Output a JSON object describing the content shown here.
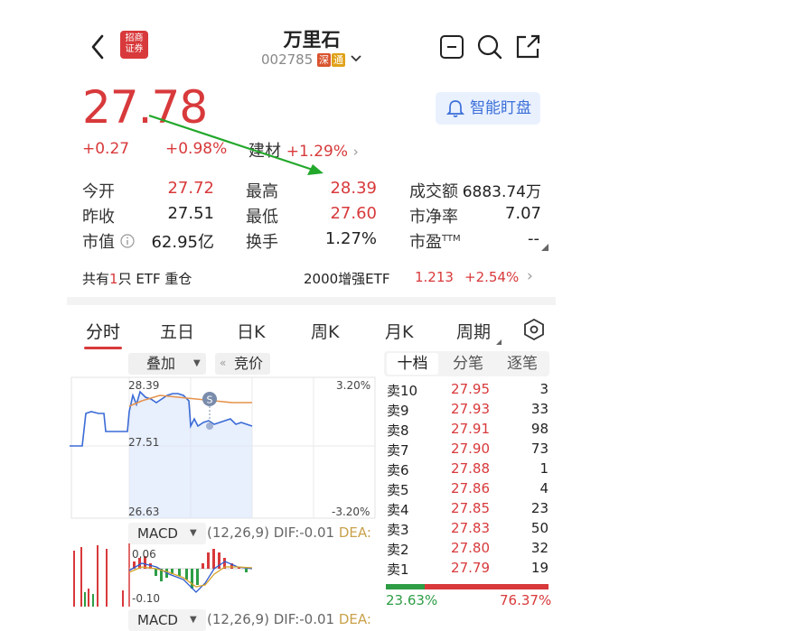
{
  "header": {
    "back_icon": "chevron-left-icon",
    "broker_logo_text": "招商证券",
    "title": "万里石",
    "code": "002785",
    "badge_market": "深",
    "badge_tong": "通",
    "actions": [
      "minus-box-icon",
      "search-icon",
      "share-icon"
    ]
  },
  "quote": {
    "price": "27.78",
    "change": "+0.27",
    "change_pct": "+0.98%",
    "sector_name": "建材",
    "sector_pct": "+1.29%",
    "watch_label": "智能盯盘"
  },
  "stats": {
    "open_label": "今开",
    "open": "27.72",
    "high_label": "最高",
    "high": "28.39",
    "turnover_amt_label": "成交额",
    "turnover_amt": "6883.74万",
    "prev_close_label": "昨收",
    "prev_close": "27.51",
    "low_label": "最低",
    "low": "27.60",
    "pb_label": "市净率",
    "pb": "7.07",
    "mcap_label": "市值",
    "mcap": "62.95亿",
    "turnover_label": "换手",
    "turnover": "1.27%",
    "pe_label": "市盈",
    "pe_sup": "TTM",
    "pe": "--"
  },
  "etf": {
    "p1": "共有",
    "count": "1",
    "p2": "只 ETF 重仓",
    "name": "2000增强ETF",
    "price": "1.213",
    "pct": "+2.54%"
  },
  "tabs": [
    "分时",
    "五日",
    "日K",
    "周K",
    "月K",
    "周期"
  ],
  "chart_toolbar": {
    "overlay": "叠加",
    "auction": "竞价"
  },
  "chart_labels": {
    "top": "28.39",
    "mid": "27.51",
    "bot": "26.63",
    "pct_top": "3.20%",
    "pct_bot": "-3.20%",
    "marker": "S"
  },
  "macd": {
    "label": "MACD",
    "params": "(12,26,9)",
    "dif": "DIF:-0.01",
    "dea": "DEA:",
    "top": "0.06",
    "bot": "-0.10"
  },
  "orderbook_tabs": [
    "十档",
    "分笔",
    "逐笔"
  ],
  "orderbook": [
    {
      "label": "卖10",
      "price": "27.95",
      "vol": "3"
    },
    {
      "label": "卖9",
      "price": "27.93",
      "vol": "33"
    },
    {
      "label": "卖8",
      "price": "27.91",
      "vol": "98"
    },
    {
      "label": "卖7",
      "price": "27.90",
      "vol": "73"
    },
    {
      "label": "卖6",
      "price": "27.88",
      "vol": "1"
    },
    {
      "label": "卖5",
      "price": "27.86",
      "vol": "4"
    },
    {
      "label": "卖4",
      "price": "27.85",
      "vol": "23"
    },
    {
      "label": "卖3",
      "price": "27.83",
      "vol": "50"
    },
    {
      "label": "卖2",
      "price": "27.80",
      "vol": "32"
    },
    {
      "label": "卖1",
      "price": "27.79",
      "vol": "19"
    }
  ],
  "ratio": {
    "buy": "23.63%",
    "sell": "76.37%",
    "buy_frac": 0.2363
  },
  "colors": {
    "red": "#d8393b",
    "green": "#2e9d46",
    "arrow": "#22a82b",
    "blue": "#3b6fd8"
  }
}
